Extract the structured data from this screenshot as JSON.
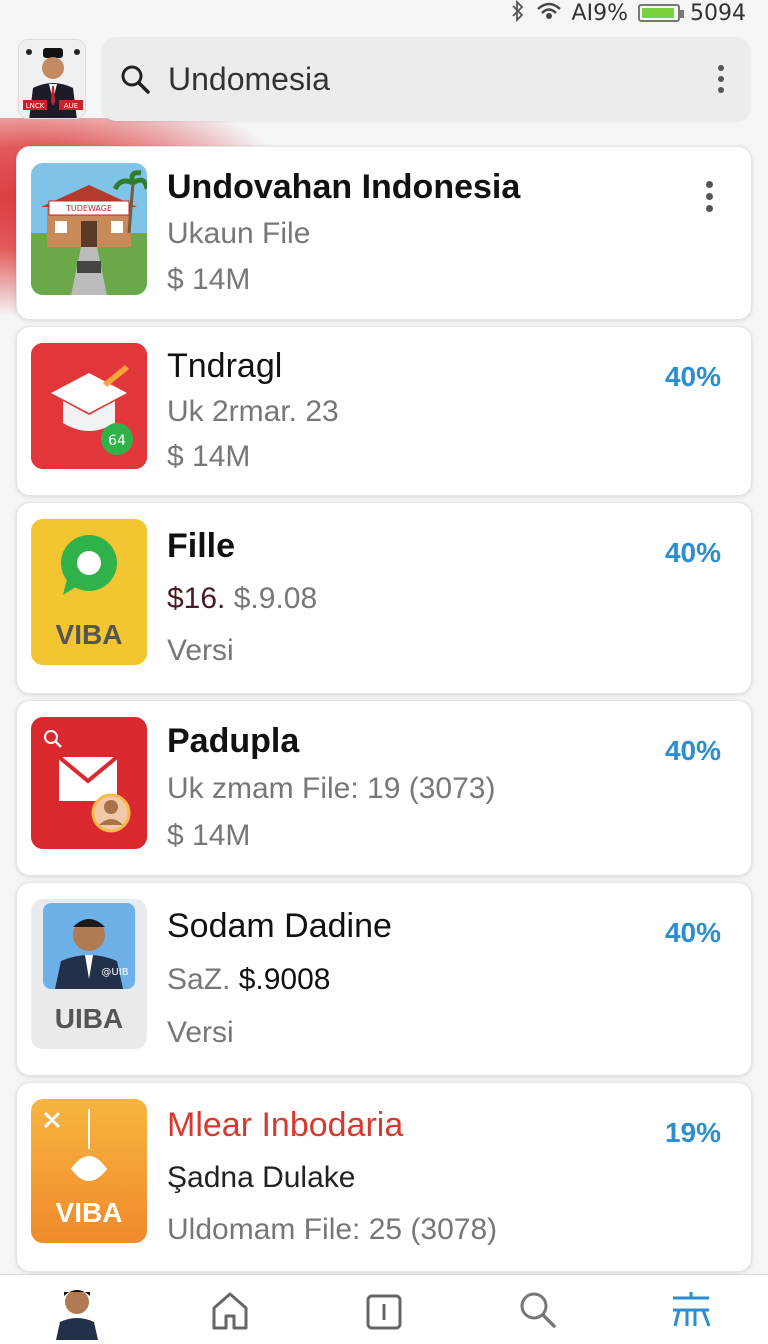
{
  "status_bar": {
    "battery_percent": "‎ΑI9%",
    "time": "5094",
    "battery_level": 0.95
  },
  "search": {
    "value": "Undomesia",
    "icon": "search-icon"
  },
  "cards": [
    {
      "title": "Undovahan Indonesia",
      "line1": "Ukaun File",
      "line2": "$ 14M",
      "thumb_icon": "house-photo",
      "menu_icon": "kebab-menu-icon",
      "thumb_sign": "TUDEWAGE"
    },
    {
      "title": "Tndragl",
      "line1": "Uk 2rmar. 23",
      "line2": "$ 14M",
      "percent": "40%",
      "thumb_icon": "graduation-cap-icon",
      "thumb_color": "#e2373a",
      "badge": "64"
    },
    {
      "title": "Fille",
      "line1_a": "$16.",
      "line1_b": "$.9.08",
      "line2": "Versi",
      "percent": "40%",
      "thumb_icon": "chat-bubble-icon",
      "thumb_color": "#f2c531",
      "thumb_label": "VIBA"
    },
    {
      "title": "Padupla",
      "line1": "Uk zmam File: 19 (3073)",
      "line2": "$ 14M",
      "percent": "40%",
      "thumb_icon": "mail-icon",
      "thumb_color": "#d9292f"
    },
    {
      "title": "Sodam Dadine",
      "line1_a": "SaZ.",
      "line1_b": "$.9008",
      "line2": "Versi",
      "percent": "40%",
      "thumb_icon": "person-photo",
      "thumb_label": "UIBA",
      "photo_tag": "@UIB"
    },
    {
      "title": "Mlear Inbodaria",
      "line1": "Şadna Dulake",
      "line2": "Uldomam File: 25 (3078)",
      "percent": "19%",
      "thumb_icon": "lightbulb-icon",
      "thumb_color": "#f39a2f",
      "thumb_label": "VIBA"
    }
  ],
  "bottom_nav": [
    "profile-avatar",
    "home-icon",
    "info-icon",
    "search-icon",
    "translate-icon"
  ],
  "colors": {
    "accent_blue": "#2a8ecf",
    "accent_red": "#d63a2f"
  },
  "top_avatar_labels": [
    "LNCK",
    "AUE"
  ]
}
